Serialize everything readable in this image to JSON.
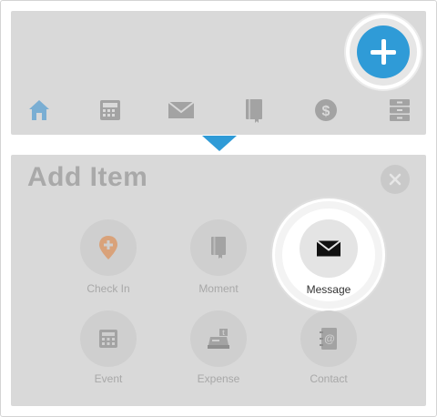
{
  "toolbar": {
    "nav_items": [
      {
        "icon": "home-icon",
        "active": true
      },
      {
        "icon": "calculator-icon",
        "active": false
      },
      {
        "icon": "envelope-icon",
        "active": false
      },
      {
        "icon": "book-icon",
        "active": false
      },
      {
        "icon": "dollar-icon",
        "active": false
      },
      {
        "icon": "cabinet-icon",
        "active": false
      }
    ],
    "add_button_icon": "plus-icon"
  },
  "panel": {
    "title": "Add Item",
    "close_icon": "close-icon",
    "items": [
      {
        "label": "Check In",
        "icon": "location-pin-icon"
      },
      {
        "label": "Moment",
        "icon": "book-icon"
      },
      {
        "label": "Message",
        "icon": "envelope-icon",
        "highlighted": true
      },
      {
        "label": "Event",
        "icon": "calculator-icon"
      },
      {
        "label": "Expense",
        "icon": "cash-register-icon"
      },
      {
        "label": "Contact",
        "icon": "address-book-icon"
      }
    ]
  },
  "colors": {
    "accent": "#2f9bd7",
    "checkin_accent": "#d9a27a",
    "panel_bg": "#d9d9d9",
    "icon_muted": "#a3a3a3"
  }
}
